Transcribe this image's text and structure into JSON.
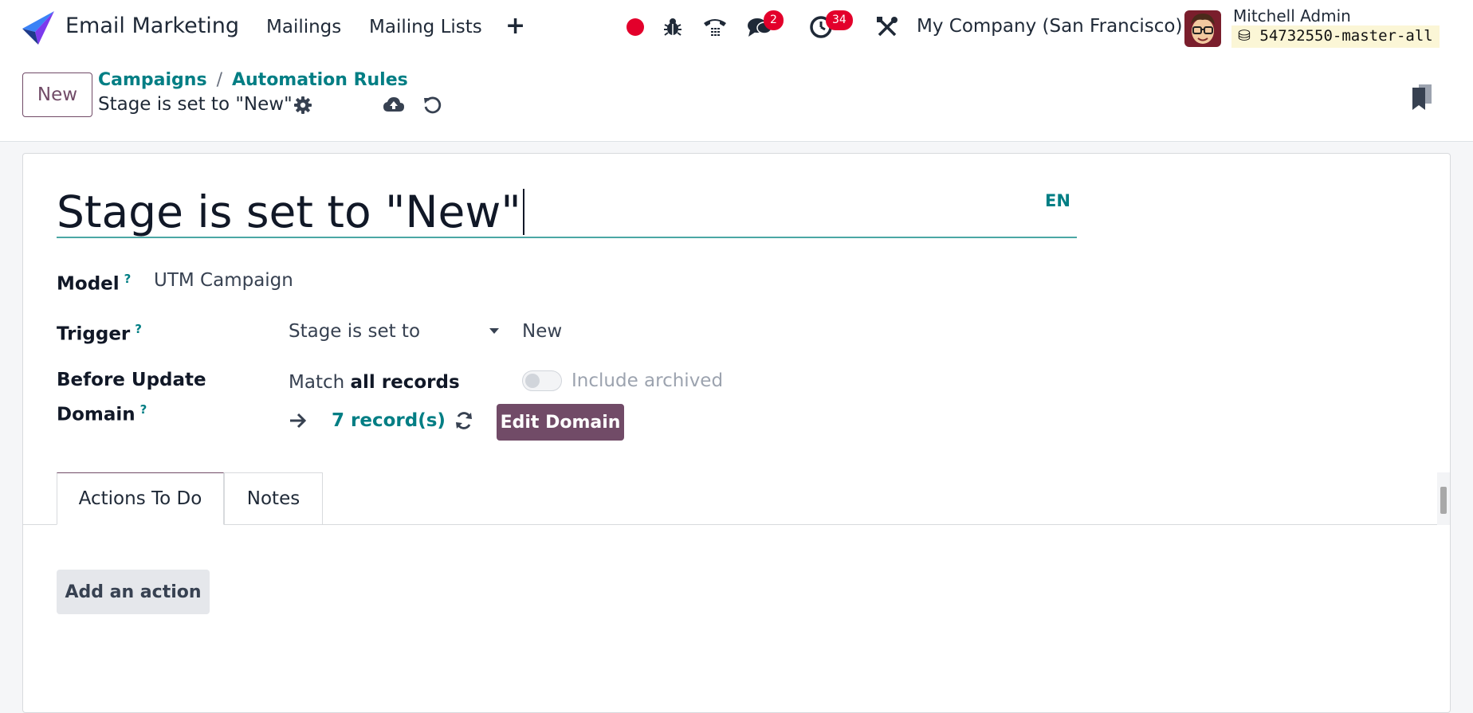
{
  "navbar": {
    "app_name": "Email Marketing",
    "menu": [
      "Mailings",
      "Mailing Lists"
    ],
    "plus_label": "+",
    "messages_count": "2",
    "activities_count": "34",
    "company": "My Company (San Francisco)",
    "user_name": "Mitchell Admin",
    "database": "54732550-master-all"
  },
  "control_panel": {
    "new_label": "New",
    "breadcrumb": [
      "Campaigns",
      "Automation Rules"
    ],
    "breadcrumb_sep": "/",
    "record_title": "Stage is set to \"New\""
  },
  "form": {
    "name": "Stage is set to \"New\"",
    "lang": "EN",
    "help_mark": "?",
    "model_label": "Model",
    "model_value": "UTM Campaign",
    "trigger_label": "Trigger",
    "trigger_value": "Stage is set to",
    "trigger_stage": "New",
    "before_domain_label_1": "Before Update",
    "before_domain_label_2": "Domain",
    "match_prefix": "Match",
    "match_bold": "all records",
    "include_archived": "Include archived",
    "records_link": "7 record(s)",
    "edit_domain_label": "Edit Domain"
  },
  "tabs": [
    {
      "label": "Actions To Do",
      "active": true
    },
    {
      "label": "Notes",
      "active": false
    }
  ],
  "actions": {
    "add_label": "Add an action"
  },
  "colors": {
    "brand": "#714b67",
    "teal": "#017e84",
    "badge": "#e3002b"
  }
}
